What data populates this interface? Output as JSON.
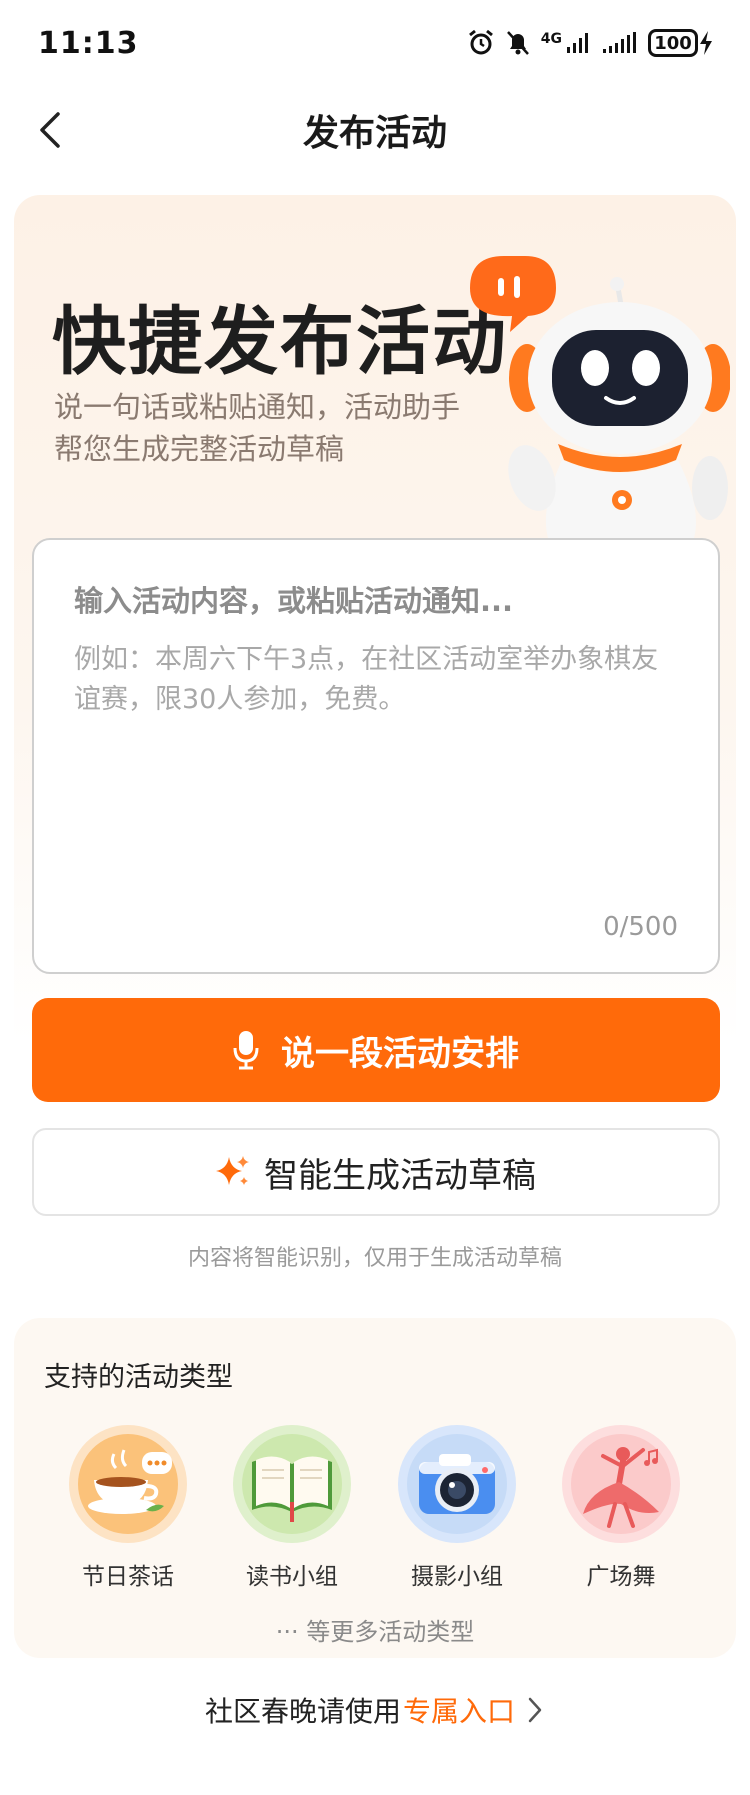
{
  "status_bar": {
    "time": "11:13",
    "network": "4G",
    "battery": "100"
  },
  "header": {
    "title": "发布活动"
  },
  "hero": {
    "title": "快捷发布活动",
    "subtitle": "说一句话或粘贴通知，活动助手帮您生成完整活动草稿"
  },
  "input": {
    "placeholder": "输入活动内容，或粘贴活动通知...",
    "example": "例如：本周六下午3点，在社区活动室举办象棋友谊赛，限30人参加，免费。",
    "counter": "0/500"
  },
  "actions": {
    "voice_label": "说一段活动安排",
    "draft_label": "智能生成活动草稿",
    "hint": "内容将智能识别，仅用于生成活动草稿"
  },
  "types": {
    "title": "支持的活动类型",
    "items": [
      {
        "label": "节日茶话",
        "icon": "tea-cup-icon"
      },
      {
        "label": "读书小组",
        "icon": "open-book-icon"
      },
      {
        "label": "摄影小组",
        "icon": "camera-icon"
      },
      {
        "label": "广场舞",
        "icon": "dancer-icon"
      }
    ],
    "more": "··· 等更多活动类型"
  },
  "footer": {
    "prefix": "社区春晚请使用",
    "link": "专属入口"
  },
  "colors": {
    "accent": "#ff6a0a",
    "hero_bg": "#fdf1e6"
  }
}
